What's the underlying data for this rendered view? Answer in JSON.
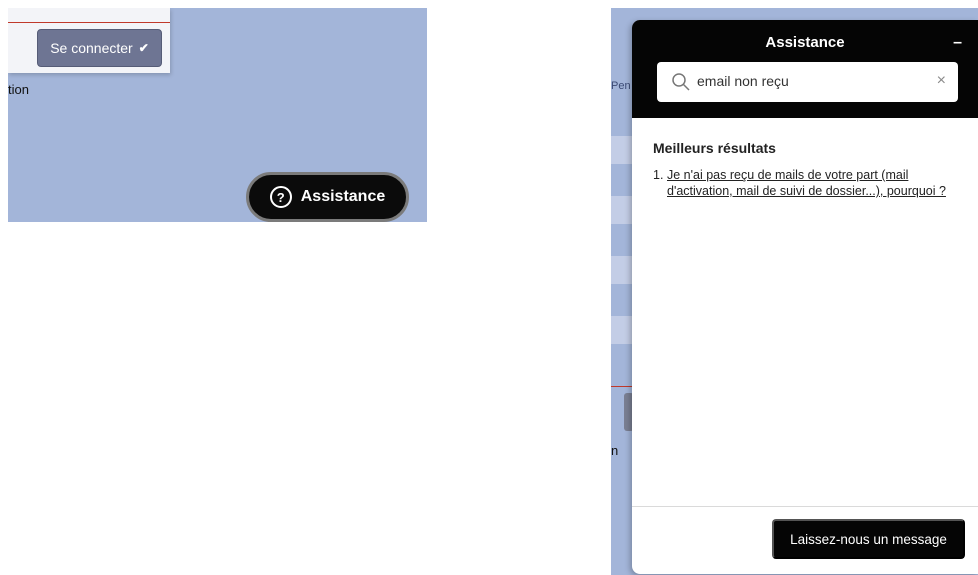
{
  "left_view": {
    "login_button": {
      "label": "Se connecter",
      "check_icon": "✔"
    },
    "cut_text": "tion",
    "assistance_pill": {
      "icon_label": "?",
      "label": "Assistance"
    }
  },
  "right_view": {
    "bg_cut_text_1": "Pen",
    "bg_cut_text_2": "n"
  },
  "widget": {
    "title": "Assistance",
    "minimize_symbol": "–",
    "search": {
      "value": "email non reçu",
      "clear_symbol": "×"
    },
    "results_title": "Meilleurs résultats",
    "results": [
      {
        "number": "1.",
        "text": "Je n'ai pas reçu de mails de votre part (mail d'activation, mail de suivi de dossier...), pourquoi ?"
      }
    ],
    "message_button": "Laissez-nous un message"
  },
  "colors": {
    "page_bg": "#a3b5d9",
    "header_bg": "#050505",
    "accent_red": "#c0392b",
    "login_button_bg": "#6e7593"
  }
}
